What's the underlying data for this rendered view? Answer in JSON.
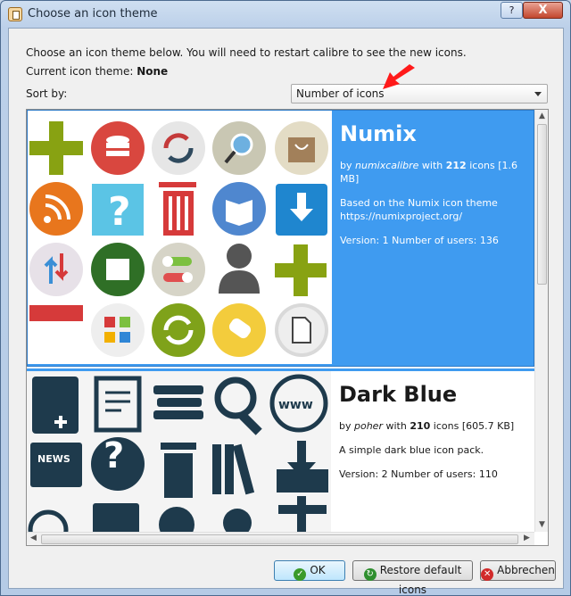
{
  "window": {
    "title": "Choose an icon theme",
    "help_label": "?",
    "close_label": "X"
  },
  "dialog": {
    "description": "Choose an icon theme below. You will need to restart calibre to see the new icons.",
    "current_label": "Current icon theme:",
    "current_value": "None",
    "sort_label": "Sort by:",
    "sort_value": "Number of icons"
  },
  "themes": [
    {
      "name": "Numix",
      "by": "by",
      "author": "numixcalibre",
      "with": "with",
      "count": "212",
      "icons_label": "icons",
      "size": "[1.6 MB]",
      "description": "Based on the Numix icon theme https://numixproject.org/",
      "version_line": "Version: 1 Number of users: 136",
      "selected": true
    },
    {
      "name": "Dark Blue",
      "by": "by",
      "author": "poher",
      "with": "with",
      "count": "210",
      "icons_label": "icons",
      "size": "[605.7 KB]",
      "description": "A simple dark blue icon pack.",
      "version_line": "Version: 2 Number of users: 110",
      "selected": false
    }
  ],
  "buttons": {
    "ok": "OK",
    "restore": "Restore default icons",
    "cancel": "Abbrechen"
  },
  "colors": {
    "selection": "#3f9bf0",
    "arrow": "#ff0000",
    "dark_blue_icon": "#1e3a4c"
  }
}
